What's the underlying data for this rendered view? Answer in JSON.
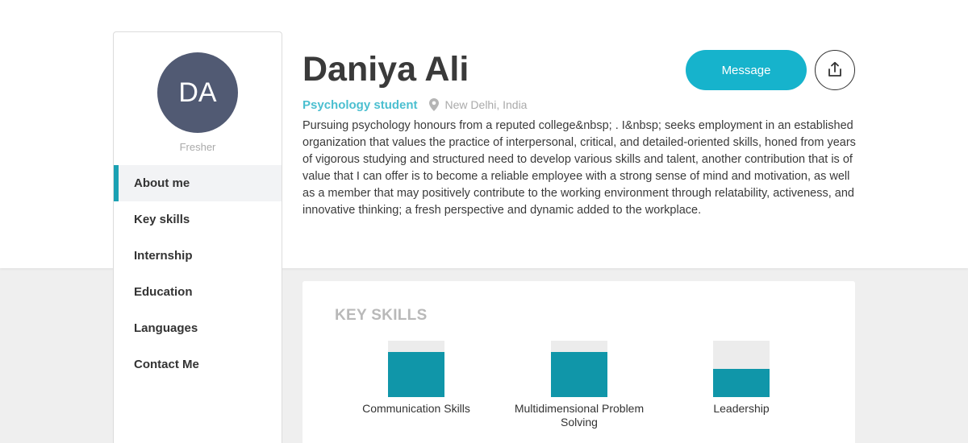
{
  "profile": {
    "initials": "DA",
    "experience": "Fresher",
    "name": "Daniya Ali",
    "role": "Psychology student",
    "location": "New Delhi, India",
    "summary": "Pursuing psychology honours from a reputed college&nbsp; . I&nbsp; seeks employment in an established organization that values the practice of interpersonal, critical, and detailed-oriented skills, honed from years of vigorous studying and structured need to develop various skills and talent, another contribution that is of value that I can offer is to become a reliable employee with a strong sense of mind and motivation, as well as a member that may positively contribute to the working environment through relatability, activeness, and innovative thinking; a fresh perspective and dynamic added to the workplace."
  },
  "actions": {
    "message_label": "Message",
    "share_icon": "share-icon"
  },
  "sidebar": {
    "items": [
      {
        "label": "About me",
        "active": true
      },
      {
        "label": "Key skills"
      },
      {
        "label": "Internship"
      },
      {
        "label": "Education"
      },
      {
        "label": "Languages"
      },
      {
        "label": "Contact Me"
      }
    ]
  },
  "key_skills": {
    "title": "KEY SKILLS",
    "skills": [
      {
        "label": "Communication Skills",
        "level": 0.8
      },
      {
        "label": "Multidimensional Problem Solving",
        "level": 0.8
      },
      {
        "label": "Leadership",
        "level": 0.5
      }
    ]
  },
  "colors": {
    "accent": "#16b3cc",
    "bar_fill": "#1096a9",
    "avatar_bg": "#515a73",
    "role_text": "#4bbfd0"
  }
}
